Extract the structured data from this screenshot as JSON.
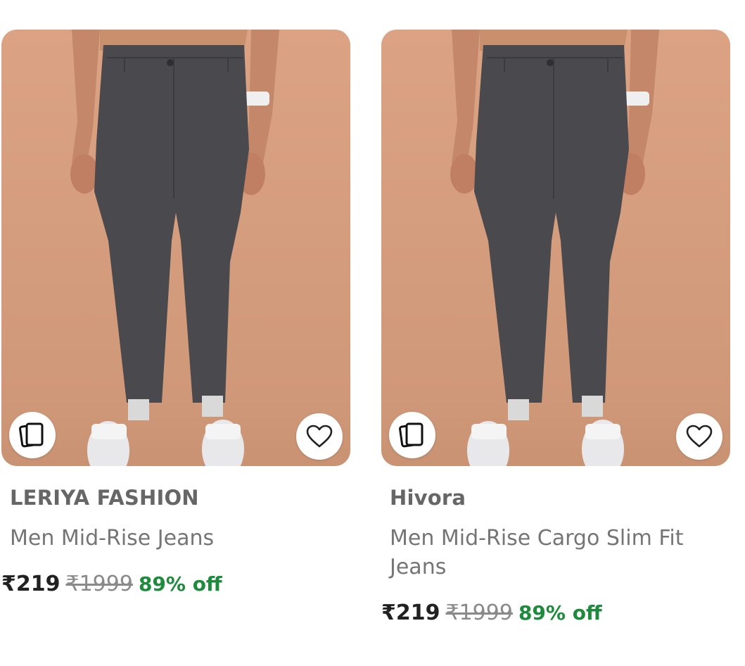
{
  "products": [
    {
      "brand": "LERIYA FASHION",
      "title": "Men Mid-Rise Jeans",
      "price": "₹219",
      "mrp": "₹1999",
      "discount": "89% off",
      "image": "product-photo-grey-trousers"
    },
    {
      "brand": "Hivora",
      "title": "Men Mid-Rise Cargo Slim Fit Jeans",
      "price": "₹219",
      "mrp": "₹1999",
      "discount": "89% off",
      "image": "product-photo-grey-trousers"
    }
  ],
  "icons": {
    "compare": "compare-cards-icon",
    "wishlist": "heart-outline-icon"
  },
  "colors": {
    "price": "#212121",
    "mrp": "#8a8a8a",
    "discount": "#1e8a3c",
    "brand": "#666666",
    "image_background": "#d9a180",
    "trousers": "#4a4a4e"
  }
}
